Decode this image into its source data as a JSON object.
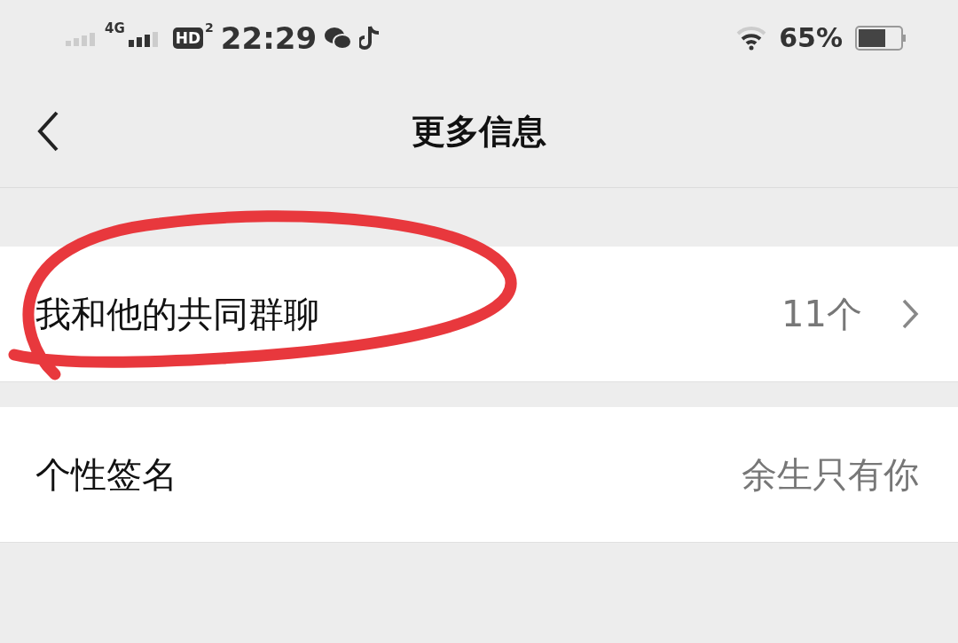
{
  "status_bar": {
    "network": "4G",
    "hd": "HD",
    "hd_sub": "2",
    "time": "22:29",
    "battery_percent": "65%"
  },
  "nav": {
    "title": "更多信息"
  },
  "rows": [
    {
      "kind": "link",
      "label": "我和他的共同群聊",
      "value": "11个",
      "circled": true
    },
    {
      "kind": "value",
      "label": "个性签名",
      "value": "余生只有你",
      "circled": false
    }
  ]
}
